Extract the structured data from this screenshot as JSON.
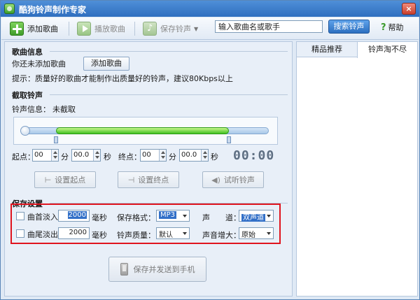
{
  "window": {
    "title": "酷狗铃声制作专家",
    "close_glyph": "×"
  },
  "toolbar": {
    "add_song": "添加歌曲",
    "play_song": "播放歌曲",
    "save_ringtone": "保存铃声",
    "dropdown_glyph": "▼",
    "search_placeholder": "输入歌曲名或歌手",
    "search_button": "搜索铃声",
    "help": "帮助",
    "help_glyph": "?"
  },
  "song_info": {
    "title": "歌曲信息",
    "status": "你还未添加歌曲",
    "add_button": "添加歌曲",
    "hint": "提示：质量好的歌曲才能制作出质量好的铃声，建议80Kbps以上"
  },
  "clip": {
    "title": "截取铃声",
    "info_label": "铃声信息：",
    "info_value": "未截取",
    "slider": {
      "start_fraction": 0.14,
      "end_fraction": 0.84
    },
    "start_label": "起点：",
    "end_label": "终点：",
    "start_min": "00",
    "start_sec": "00.0",
    "end_min": "00",
    "end_sec": "00.0",
    "unit_min": "分",
    "unit_sec": "秒",
    "time_display": "00:00",
    "set_start": "设置起点",
    "set_end": "设置终点",
    "preview": "试听铃声"
  },
  "save": {
    "title": "保存设置",
    "fade_in_label": "曲首淡入",
    "fade_in_value": "2000",
    "fade_out_label": "曲尾淡出",
    "fade_out_value": "2000",
    "ms": "毫秒",
    "format_label": "保存格式：",
    "format_value": "MP3",
    "channel_label": "声　　道：",
    "channel_value": "双声道",
    "quality_label": "铃声质量：",
    "quality_value": "默认",
    "volume_label": "声音增大：",
    "volume_value": "原始",
    "send_button": "保存并发送到手机"
  },
  "right_tabs": [
    {
      "label": "精品推荐"
    },
    {
      "label": "铃声淘不尽"
    }
  ],
  "colors": {
    "accent": "#2f6fbf",
    "highlight_box": "#e0141e",
    "slider_fill": "#3fc020"
  }
}
